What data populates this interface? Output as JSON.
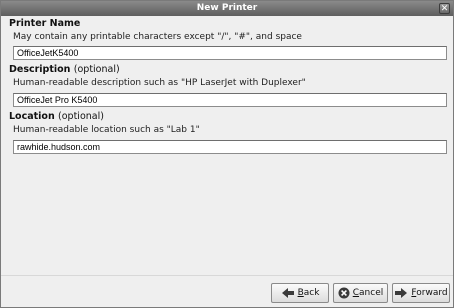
{
  "window": {
    "title": "New Printer",
    "close_glyph": "✕"
  },
  "printer_name": {
    "heading": "Printer Name",
    "hint": "May contain any printable characters except \"/\", \"#\", and space",
    "value": "OfficeJetK5400"
  },
  "description": {
    "heading": "Description",
    "optional": "(optional)",
    "hint": "Human-readable description such as \"HP LaserJet with Duplexer\"",
    "value": "OfficeJet Pro K5400"
  },
  "location": {
    "heading": "Location",
    "optional": "(optional)",
    "hint": "Human-readable location such as \"Lab 1\"",
    "value": "rawhide.hudson.com"
  },
  "buttons": {
    "back": {
      "mnemonic": "B",
      "rest": "ack",
      "icon": "arrow-left-icon"
    },
    "cancel": {
      "mnemonic": "C",
      "rest": "ancel",
      "icon": "cancel-icon"
    },
    "forward": {
      "mnemonic": "F",
      "rest": "orward",
      "icon": "arrow-right-icon"
    }
  }
}
